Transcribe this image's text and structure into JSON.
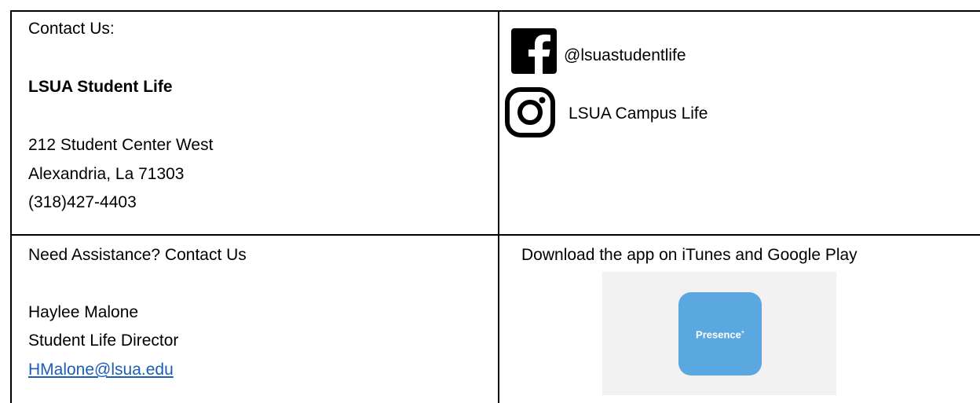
{
  "contact": {
    "heading": "Contact Us:",
    "org_name": "LSUA Student Life",
    "address_line1": "212 Student Center West",
    "address_line2": "Alexandria, La 71303",
    "phone": "(318)427-4403"
  },
  "social": {
    "facebook_icon": "facebook-icon",
    "facebook_handle": "@lsuastudentlife",
    "instagram_icon": "instagram-icon",
    "instagram_name": "LSUA Campus Life"
  },
  "assistance": {
    "heading": "Need Assistance? Contact Us",
    "name": "Haylee Malone",
    "title": "Student Life Director",
    "email": "HMalone@lsua.edu"
  },
  "app": {
    "heading": "Download the app on iTunes and Google Play",
    "app_name": "Presence",
    "tile_color": "#5ba8e0"
  }
}
